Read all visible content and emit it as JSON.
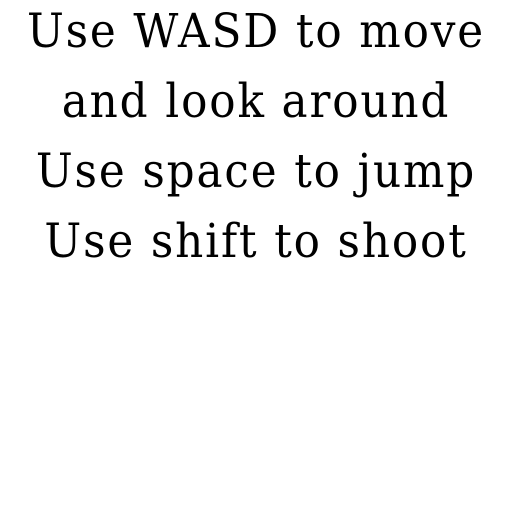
{
  "instructions": {
    "lines": [
      "Use WASD to move",
      "and look around",
      "Use space to jump",
      "Use shift to shoot"
    ]
  },
  "colors": {
    "background": "#ffffff",
    "text": "#000000"
  }
}
